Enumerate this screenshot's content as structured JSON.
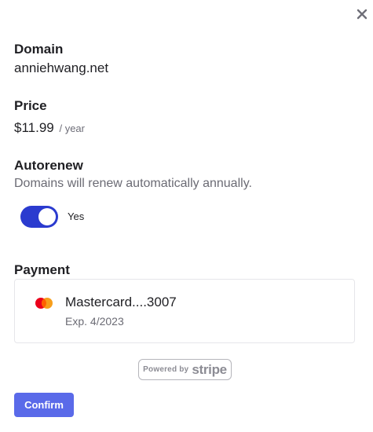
{
  "close": {
    "icon": "close-icon"
  },
  "domain": {
    "label": "Domain",
    "value": "anniehwang.net"
  },
  "price": {
    "label": "Price",
    "amount": "$11.99",
    "unit": "/ year"
  },
  "autorenew": {
    "label": "Autorenew",
    "description": "Domains will renew automatically annually.",
    "toggle_state": "on",
    "toggle_label": "Yes",
    "accent_color": "#2b3bcf"
  },
  "payment": {
    "label": "Payment",
    "card_brand_icon": "mastercard-icon",
    "card_name": "Mastercard....3007",
    "card_expiry": "Exp. 4/2023"
  },
  "stripe": {
    "powered_by": "Powered by",
    "brand": "stripe"
  },
  "actions": {
    "confirm_label": "Confirm",
    "confirm_color": "#5a6ae9"
  }
}
